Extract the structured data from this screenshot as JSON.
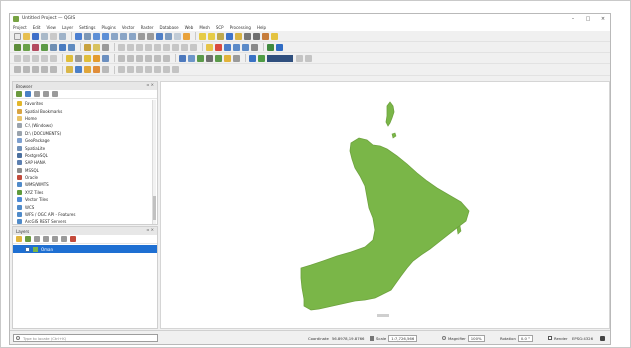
{
  "window": {
    "title": "Untitled Project — QGIS",
    "controls": [
      "–",
      "□",
      "×"
    ]
  },
  "menu": [
    "Project",
    "Edit",
    "View",
    "Layer",
    "Settings",
    "Plugins",
    "Vector",
    "Raster",
    "Database",
    "Web",
    "Mesh",
    "SCP",
    "Processing",
    "Help"
  ],
  "browser": {
    "title": "Browser",
    "tree": [
      {
        "label": "Favorites",
        "icon": "star-icon",
        "color": "#e2b62b"
      },
      {
        "label": "Spatial Bookmarks",
        "icon": "bookmark-icon",
        "color": "#d9a441"
      },
      {
        "label": "Home",
        "icon": "folder-icon",
        "color": "#e9c46a"
      },
      {
        "label": "C:\\ (Windows)",
        "icon": "drive-icon",
        "color": "#9aa3ad"
      },
      {
        "label": "D:\\ (DOCUMENTS)",
        "icon": "drive-icon",
        "color": "#9aa3ad"
      },
      {
        "label": "GeoPackage",
        "icon": "geopackage-icon",
        "color": "#7d9fcf"
      },
      {
        "label": "SpatiaLite",
        "icon": "spatialite-icon",
        "color": "#6e8fb8"
      },
      {
        "label": "PostgreSQL",
        "icon": "postgresql-icon",
        "color": "#4a6f9e"
      },
      {
        "label": "SAP HANA",
        "icon": "database-icon",
        "color": "#5c7fb0"
      },
      {
        "label": "MSSQL",
        "icon": "database-icon",
        "color": "#8c8c8c"
      },
      {
        "label": "Oracle",
        "icon": "database-icon",
        "color": "#c24b3b"
      },
      {
        "label": "WMS/WMTS",
        "icon": "globe-icon",
        "color": "#4f8ac9"
      },
      {
        "label": "XYZ Tiles",
        "icon": "tiles-icon",
        "color": "#5e9a3a"
      },
      {
        "label": "Vector Tiles",
        "icon": "tiles-icon",
        "color": "#4d8ad6"
      },
      {
        "label": "WCS",
        "icon": "globe-icon",
        "color": "#4f8ac9"
      },
      {
        "label": "WFS / OGC API - Features",
        "icon": "globe-icon",
        "color": "#4f8ac9"
      },
      {
        "label": "ArcGIS REST Servers",
        "icon": "globe-icon",
        "color": "#4f8ac9"
      }
    ]
  },
  "layers": {
    "title": "Layers",
    "items": [
      {
        "label": "Oman",
        "fill": "#7ab648",
        "checked": true
      }
    ]
  },
  "map": {
    "layer_fill": "#7ab648",
    "layer_stroke": "#6ea23f",
    "background": "#ffffff"
  },
  "status": {
    "locator_placeholder": "Type to locate (Ctrl+K)",
    "coordinate_label": "Coordinate",
    "coordinate_value": "56.8978,19.8766",
    "scale_label": "Scale",
    "scale_value": "1:7,726,566",
    "magnifier_label": "Magnifier",
    "magnifier_value": "100%",
    "rotation_label": "Rotation",
    "rotation_value": "0.0 °",
    "render_label": "Render",
    "crs_label": "EPSG:4326"
  },
  "colors": {
    "selection_blue": "#1e6fd2",
    "qgis_green": "#77a343",
    "polygon_green": "#7ab648"
  }
}
